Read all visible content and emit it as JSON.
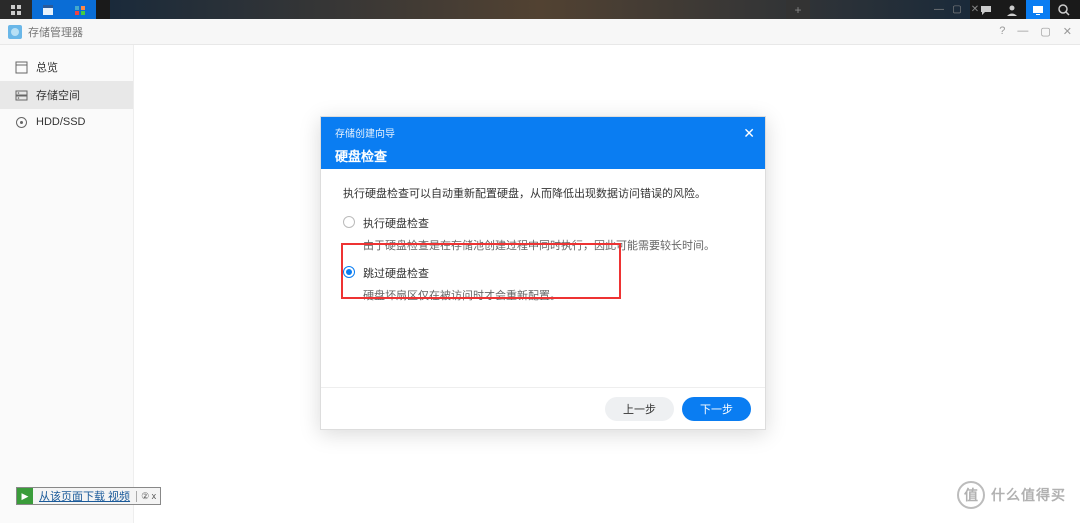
{
  "taskbar": {
    "plus_label": "+",
    "icons": {
      "chat": "chat-icon",
      "user": "user-icon",
      "screen": "screen-icon",
      "search": "search-icon"
    }
  },
  "window": {
    "title": "存储管理器",
    "controls": {
      "help": "?",
      "min": "—",
      "max": "▢",
      "close": "✕"
    }
  },
  "sidebar": {
    "items": [
      {
        "label": "总览",
        "icon": "overview-icon"
      },
      {
        "label": "存储空间",
        "icon": "storage-icon"
      },
      {
        "label": "HDD/SSD",
        "icon": "disk-icon"
      }
    ]
  },
  "modal": {
    "breadcrumb": "存储创建向导",
    "title": "硬盘检查",
    "close": "✕",
    "description": "执行硬盘检查可以自动重新配置硬盘，从而降低出现数据访问错误的风险。",
    "options": [
      {
        "label": "执行硬盘检查",
        "desc": "由于硬盘检查是在存储池创建过程中同时执行，因此可能需要较长时间。",
        "checked": false
      },
      {
        "label": "跳过硬盘检查",
        "desc": "硬盘坏扇区仅在被访问时才会重新配置。",
        "checked": true
      }
    ],
    "buttons": {
      "prev": "上一步",
      "next": "下一步"
    }
  },
  "download_bar": {
    "text": "从该页面下载 视频",
    "badge": "② x"
  },
  "watermark": {
    "symbol": "值",
    "text": "什么值得买"
  }
}
